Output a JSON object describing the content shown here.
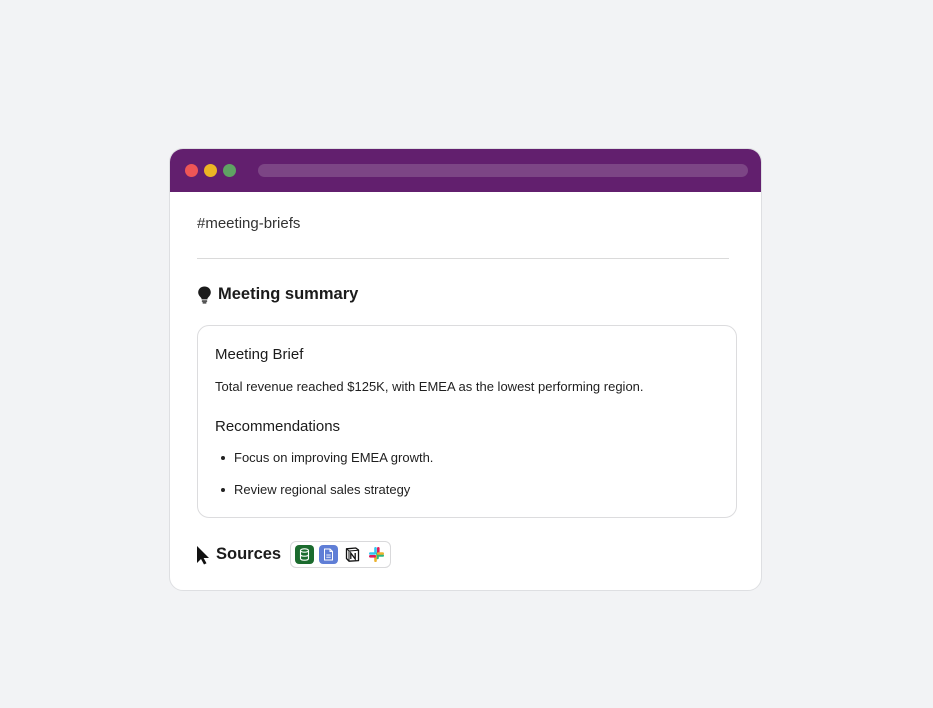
{
  "window": {
    "channel": "#meeting-briefs"
  },
  "summary": {
    "heading": "Meeting summary",
    "icon": "lightbulb-icon"
  },
  "card": {
    "title": "Meeting Brief",
    "text": "Total revenue reached $125K, with EMEA as the lowest performing region.",
    "recommendations_title": "Recommendations",
    "recommendations": [
      "Focus on improving EMEA growth.",
      "Review regional sales strategy"
    ]
  },
  "sources": {
    "label": "Sources",
    "icons": [
      "database-icon",
      "document-icon",
      "notion-icon",
      "slack-icon"
    ]
  },
  "colors": {
    "titlebar": "#621f6e",
    "dot_red": "#ee5656",
    "dot_yellow": "#ecb524",
    "dot_green": "#5fa363"
  }
}
